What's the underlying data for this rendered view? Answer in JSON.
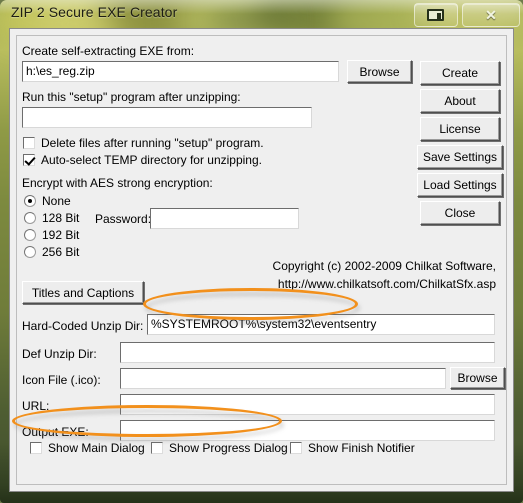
{
  "window": {
    "title": "ZIP 2 Secure EXE Creator",
    "buttons": [
      {
        "name": "restore",
        "label": ""
      },
      {
        "name": "close",
        "label": "✕"
      }
    ]
  },
  "form": {
    "source_label": "Create self-extracting EXE from:",
    "source_value": "h:\\es_reg.zip",
    "source_browse_label": "Browse",
    "setup_label": "Run this \"setup\" program after unzipping:",
    "setup_value": "",
    "delete_files_label": "Delete files after running \"setup\" program.",
    "delete_files_checked": false,
    "auto_temp_label": "Auto-select TEMP directory for unzipping.",
    "auto_temp_checked": true,
    "encrypt_label": "Encrypt with AES strong encryption:",
    "encryption_options": [
      {
        "label": "None",
        "selected": true
      },
      {
        "label": "128 Bit",
        "selected": false
      },
      {
        "label": "192 Bit",
        "selected": false
      },
      {
        "label": "256 Bit",
        "selected": false
      }
    ],
    "password_label": "Password:",
    "password_value": "",
    "titles_captions_label": "Titles and Captions",
    "copyright_line1": "Copyright (c) 2002-2009 Chilkat Software,",
    "copyright_line2": "http://www.chilkatsoft.com/ChilkatSfx.asp",
    "fields": [
      {
        "label": "Hard-Coded Unzip Dir:",
        "value": "%SYSTEMROOT%\\system32\\eventsentry"
      },
      {
        "label": "Def Unzip Dir:",
        "value": ""
      },
      {
        "label": "Icon File (.ico):",
        "value": "",
        "browse_label": "Browse"
      },
      {
        "label": "URL:",
        "value": ""
      },
      {
        "label": "Output EXE:",
        "value": ""
      }
    ],
    "dialog_options": [
      {
        "label": "Show Main Dialog",
        "checked": false
      },
      {
        "label": "Show Progress Dialog",
        "checked": false
      },
      {
        "label": "Show Finish Notifier",
        "checked": false
      }
    ]
  },
  "sidebar": {
    "buttons": [
      {
        "label": "Create"
      },
      {
        "label": "About"
      },
      {
        "label": "License"
      },
      {
        "label": "Save Settings"
      },
      {
        "label": "Load Settings"
      },
      {
        "label": "Close"
      }
    ]
  },
  "annotations": {
    "accent_color": "#f2901c",
    "items": [
      {
        "name": "hard-coded-unzip-dir-highlight"
      },
      {
        "name": "show-dialog-checkboxes-highlight"
      }
    ]
  }
}
